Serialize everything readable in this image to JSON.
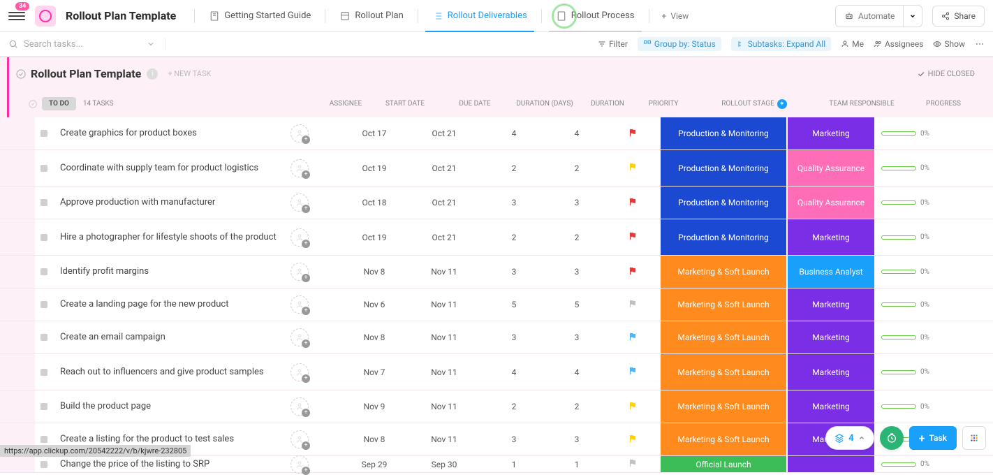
{
  "header": {
    "badge": "34",
    "title": "Rollout Plan Template",
    "tabs": [
      {
        "label": "Getting Started Guide"
      },
      {
        "label": "Rollout Plan"
      },
      {
        "label": "Rollout Deliverables"
      },
      {
        "label": "Rollout Process"
      }
    ],
    "view": "View",
    "automate": "Automate",
    "share": "Share"
  },
  "toolbar": {
    "search_placeholder": "Search tasks...",
    "filter": "Filter",
    "group_by": "Group by: Status",
    "subtasks": "Subtasks: Expand All",
    "me": "Me",
    "assignees": "Assignees",
    "show": "Show"
  },
  "list_header": {
    "title": "Rollout Plan Template",
    "new_task": "+ NEW TASK",
    "hide_closed": "HIDE CLOSED"
  },
  "group": {
    "status": "TO DO",
    "count": "14 TASKS"
  },
  "columns": {
    "assignee": "ASSIGNEE",
    "start": "START DATE",
    "due": "DUE DATE",
    "dur_days": "DURATION (DAYS)",
    "dur": "DURATION",
    "priority": "PRIORITY",
    "stage": "ROLLOUT STAGE",
    "team": "TEAM RESPONSIBLE",
    "progress": "PROGRESS"
  },
  "colors": {
    "prod_mon": "#1c49d1",
    "marketing": "#7a2fe6",
    "qa": "#ff6db8",
    "mkt_soft": "#ff8a1e",
    "biz_analyst": "#18a0fb",
    "official": "#3cbd58",
    "flag_red": "#e53935",
    "flag_yellow": "#ffd20a",
    "flag_grey": "#c1c1c1",
    "flag_blue": "#4db6f7"
  },
  "tasks": [
    {
      "name": "Create graphics for product boxes",
      "start": "Oct 17",
      "due": "Oct 21",
      "d1": "4",
      "d2": "4",
      "flag": "flag_red",
      "stage": "Production & Monitoring",
      "stage_c": "prod_mon",
      "team": "Marketing",
      "team_c": "marketing"
    },
    {
      "name": "Coordinate with supply team for product logistics",
      "start": "Oct 19",
      "due": "Oct 21",
      "d1": "2",
      "d2": "2",
      "flag": "flag_yellow",
      "stage": "Production & Monitoring",
      "stage_c": "prod_mon",
      "team": "Quality Assurance",
      "team_c": "qa",
      "tall": true
    },
    {
      "name": "Approve production with manufacturer",
      "start": "Oct 18",
      "due": "Oct 21",
      "d1": "3",
      "d2": "3",
      "flag": "flag_red",
      "stage": "Production & Monitoring",
      "stage_c": "prod_mon",
      "team": "Quality Assurance",
      "team_c": "qa"
    },
    {
      "name": "Hire a photographer for lifestyle shoots of the product",
      "start": "Oct 19",
      "due": "Oct 21",
      "d1": "2",
      "d2": "2",
      "flag": "flag_red",
      "stage": "Production & Monitoring",
      "stage_c": "prod_mon",
      "team": "Marketing",
      "team_c": "marketing",
      "tall": true
    },
    {
      "name": "Identify profit margins",
      "start": "Nov 8",
      "due": "Nov 11",
      "d1": "3",
      "d2": "3",
      "flag": "flag_red",
      "stage": "Marketing & Soft Launch",
      "stage_c": "mkt_soft",
      "team": "Business Analyst",
      "team_c": "biz_analyst"
    },
    {
      "name": "Create a landing page for the new product",
      "start": "Nov 6",
      "due": "Nov 11",
      "d1": "5",
      "d2": "5",
      "flag": "flag_grey",
      "stage": "Marketing & Soft Launch",
      "stage_c": "mkt_soft",
      "team": "Marketing",
      "team_c": "marketing"
    },
    {
      "name": "Create an email campaign",
      "start": "Nov 8",
      "due": "Nov 11",
      "d1": "3",
      "d2": "3",
      "flag": "flag_blue",
      "stage": "Marketing & Soft Launch",
      "stage_c": "mkt_soft",
      "team": "Marketing",
      "team_c": "marketing"
    },
    {
      "name": "Reach out to influencers and give product samples",
      "start": "Nov 7",
      "due": "Nov 11",
      "d1": "4",
      "d2": "4",
      "flag": "flag_blue",
      "stage": "Marketing & Soft Launch",
      "stage_c": "mkt_soft",
      "team": "Marketing",
      "team_c": "marketing",
      "tall": true
    },
    {
      "name": "Build the product page",
      "start": "Nov 9",
      "due": "Nov 11",
      "d1": "2",
      "d2": "2",
      "flag": "flag_yellow",
      "stage": "Marketing & Soft Launch",
      "stage_c": "mkt_soft",
      "team": "Marketing",
      "team_c": "marketing"
    },
    {
      "name": "Create a listing for the product to test sales",
      "start": "Nov 8",
      "due": "Nov 11",
      "d1": "3",
      "d2": "3",
      "flag": "flag_yellow",
      "stage": "Marketing & Soft Launch",
      "stage_c": "mkt_soft",
      "team": "Marketing",
      "team_c": "marketing"
    },
    {
      "name": "Change the price of the listing to SRP",
      "start": "Sep 29",
      "due": "Sep 30",
      "d1": "1",
      "d2": "1",
      "flag": "flag_grey",
      "stage": "Official Launch",
      "stage_c": "official",
      "team": "",
      "team_c": "marketing",
      "cut": true
    }
  ],
  "float": {
    "count": "4",
    "task": "Task"
  },
  "status_url": "https://app.clickup.com/20542222/v/b/kjwre-232805",
  "progress_pct": "0%"
}
